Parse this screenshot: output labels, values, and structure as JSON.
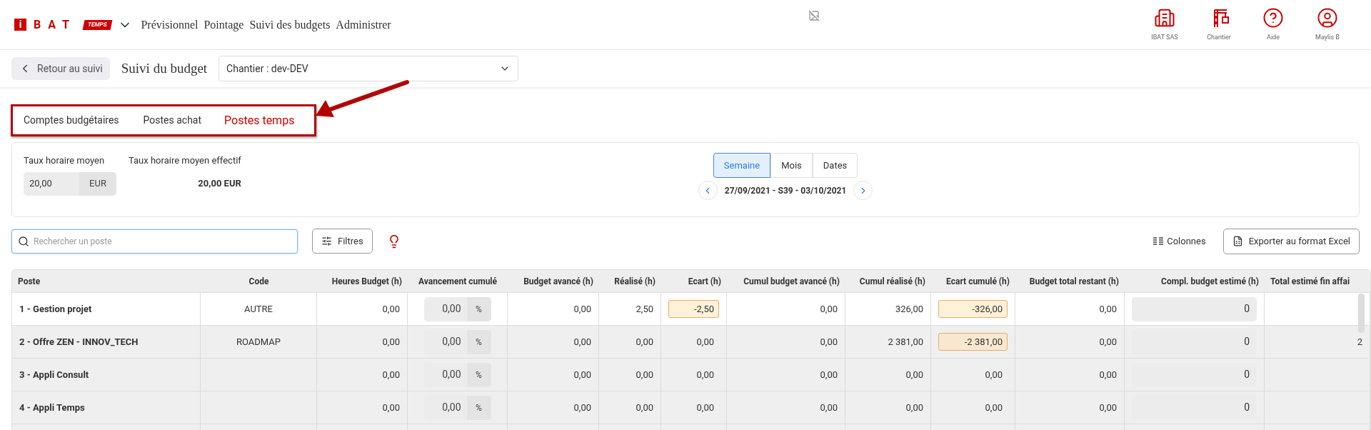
{
  "header": {
    "logo": {
      "mark": "i",
      "letters": "BAT",
      "tag": "TEMPS"
    },
    "nav": [
      "Prévisionnel",
      "Pointage",
      "Suivi des budgets",
      "Administrer"
    ],
    "actions": [
      {
        "kind": "building",
        "label": "IBAT SAS"
      },
      {
        "kind": "crane",
        "label": "Chantier"
      },
      {
        "kind": "help",
        "label": "Aide"
      },
      {
        "kind": "user",
        "label": "Maylis B"
      }
    ]
  },
  "subbar": {
    "back": "Retour au suivi",
    "title": "Suivi du budget",
    "select": "Chantier : dev-DEV"
  },
  "tabs": [
    {
      "label": "Comptes budgétaires",
      "selected": false
    },
    {
      "label": "Postes achat",
      "selected": false
    },
    {
      "label": "Postes temps",
      "selected": true
    }
  ],
  "rates": {
    "label": "Taux horaire moyen",
    "value": "20,00",
    "unit": "EUR",
    "effective_label": "Taux horaire moyen effectif",
    "effective_value": "20,00 EUR"
  },
  "period": {
    "modes": [
      {
        "label": "Semaine",
        "selected": true
      },
      {
        "label": "Mois",
        "selected": false
      },
      {
        "label": "Dates",
        "selected": false
      }
    ],
    "range": "27/09/2021 - S39 - 03/10/2021"
  },
  "toolbar": {
    "search_placeholder": "Rechercher un poste",
    "filters": "Filtres",
    "columns": "Colonnes",
    "export": "Exporter au format Excel"
  },
  "table": {
    "columns": [
      "Poste",
      "Code",
      "Heures Budget (h)",
      "Avancement cumulé",
      "Budget avancé (h)",
      "Réalisé (h)",
      "Ecart (h)",
      "Cumul budget avancé (h)",
      "Cumul réalisé (h)",
      "Ecart cumulé (h)",
      "Budget total restant (h)",
      "Compl. budget estimé (h)",
      "Total estimé fin affai"
    ],
    "rows": [
      {
        "selected": true,
        "cells": [
          {
            "kind": "label",
            "value": "1 - Gestion projet"
          },
          {
            "kind": "code",
            "value": "AUTRE"
          },
          {
            "kind": "number",
            "value": "0,00"
          },
          {
            "kind": "percent",
            "value": "0,00",
            "unit": "%"
          },
          {
            "kind": "number",
            "value": "0,00"
          },
          {
            "kind": "number",
            "value": "2,50"
          },
          {
            "kind": "deviation",
            "value": "-2,50",
            "flagged": true
          },
          {
            "kind": "number",
            "value": "0,00"
          },
          {
            "kind": "number",
            "value": "326,00"
          },
          {
            "kind": "deviation",
            "value": "-326,00",
            "flagged": true
          },
          {
            "kind": "number",
            "value": "0,00"
          },
          {
            "kind": "input",
            "value": "0"
          },
          {
            "kind": "number"
          }
        ]
      },
      {
        "selected": false,
        "cells": [
          {
            "kind": "label",
            "value": "2 - Offre ZEN - INNOV_TECH"
          },
          {
            "kind": "code",
            "value": "ROADMAP"
          },
          {
            "kind": "number",
            "value": "0,00"
          },
          {
            "kind": "percent",
            "value": "0,00",
            "unit": "%"
          },
          {
            "kind": "number",
            "value": "0,00"
          },
          {
            "kind": "number",
            "value": "0,00"
          },
          {
            "kind": "deviation",
            "value": "0,00",
            "flagged": false
          },
          {
            "kind": "number",
            "value": "0,00"
          },
          {
            "kind": "number",
            "value": "2 381,00"
          },
          {
            "kind": "deviation",
            "value": "-2 381,00",
            "flagged": true
          },
          {
            "kind": "number",
            "value": "0,00"
          },
          {
            "kind": "input",
            "value": "0"
          },
          {
            "kind": "number",
            "value": "2"
          }
        ]
      },
      {
        "selected": false,
        "cells": [
          {
            "kind": "label",
            "value": "3 - Appli Consult"
          },
          {
            "kind": "code"
          },
          {
            "kind": "number",
            "value": "0,00"
          },
          {
            "kind": "percent",
            "value": "0,00",
            "unit": "%"
          },
          {
            "kind": "number",
            "value": "0,00"
          },
          {
            "kind": "number",
            "value": "0,00"
          },
          {
            "kind": "deviation",
            "value": "0,00",
            "flagged": false
          },
          {
            "kind": "number",
            "value": "0,00"
          },
          {
            "kind": "number",
            "value": "0,00"
          },
          {
            "kind": "deviation",
            "value": "0,00",
            "flagged": false
          },
          {
            "kind": "number",
            "value": "0,00"
          },
          {
            "kind": "input",
            "value": "0"
          },
          {
            "kind": "number"
          }
        ]
      },
      {
        "selected": false,
        "cells": [
          {
            "kind": "label",
            "value": "4 - Appli Temps"
          },
          {
            "kind": "code"
          },
          {
            "kind": "number",
            "value": "0,00"
          },
          {
            "kind": "percent",
            "value": "0,00",
            "unit": "%"
          },
          {
            "kind": "number",
            "value": "0,00"
          },
          {
            "kind": "number",
            "value": "0,00"
          },
          {
            "kind": "deviation",
            "value": "0,00",
            "flagged": false
          },
          {
            "kind": "number",
            "value": "0,00"
          },
          {
            "kind": "number",
            "value": "0,00"
          },
          {
            "kind": "deviation",
            "value": "0,00",
            "flagged": false
          },
          {
            "kind": "number",
            "value": "0,00"
          },
          {
            "kind": "input",
            "value": "0"
          },
          {
            "kind": "number"
          }
        ]
      }
    ]
  }
}
